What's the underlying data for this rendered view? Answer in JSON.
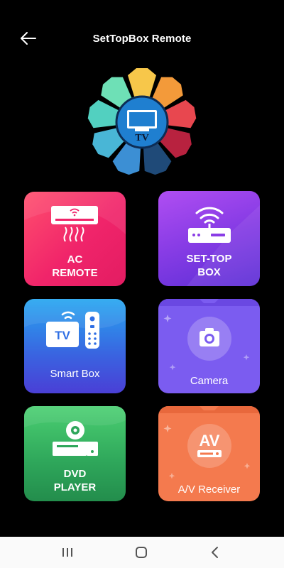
{
  "header": {
    "title": "SetTopBox Remote",
    "back_icon": "arrow-left-icon"
  },
  "logo": {
    "screen_text": "TV",
    "icon": "tv-icon"
  },
  "cards": {
    "ac": {
      "label_line1": "AC",
      "label_line2": "REMOTE",
      "icon": "air-conditioner-icon",
      "color": "#f0246a"
    },
    "stb": {
      "label_line1": "SET-TOP",
      "label_line2": "BOX",
      "icon": "router-icon",
      "color": "#8a3de6"
    },
    "smart_box": {
      "label": "Smart Box",
      "badge_text": "TV",
      "icon": "smart-tv-box-icon",
      "color": "#3a63e0"
    },
    "camera": {
      "label": "Camera",
      "icon": "camera-icon",
      "color": "#7b5cf0"
    },
    "dvd": {
      "label_line1": "DVD",
      "label_line2": "PLAYER",
      "icon": "dvd-player-icon",
      "color": "#2ea65a"
    },
    "av": {
      "label": "A/V Receiver",
      "badge_text": "AV",
      "icon": "av-receiver-icon",
      "color": "#f47a4e"
    }
  },
  "navbar": {
    "recent_icon": "recent-apps-icon",
    "home_icon": "home-icon",
    "back_icon": "back-chevron-icon"
  }
}
